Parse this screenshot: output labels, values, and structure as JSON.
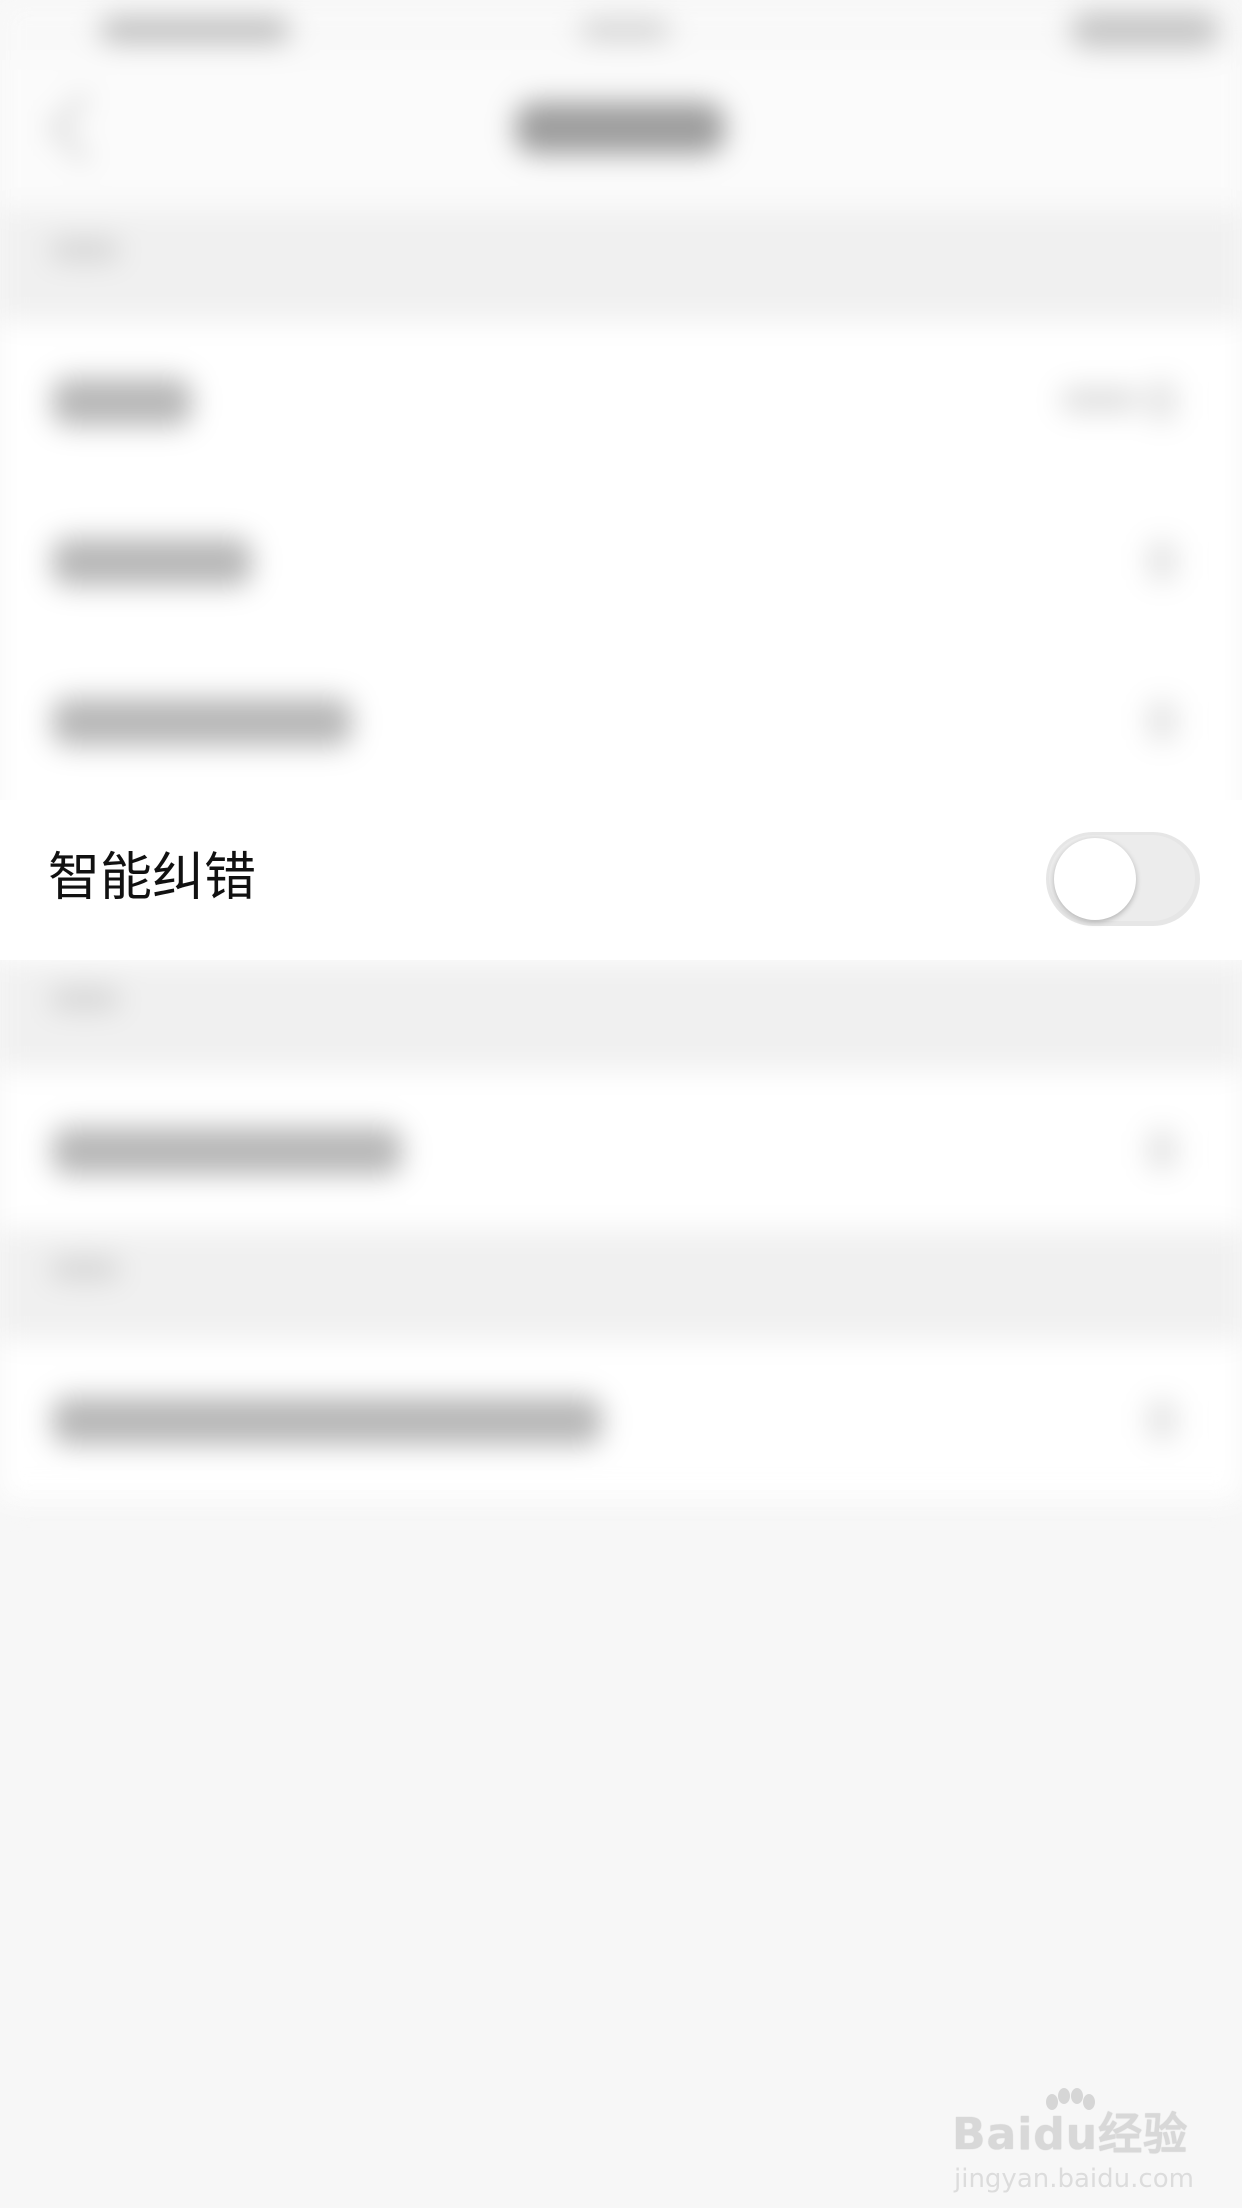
{
  "setting": {
    "label": "智能纠错",
    "enabled": false
  },
  "watermark": {
    "brand": "Baidu经验",
    "url": "jingyan.baidu.com"
  },
  "colors": {
    "background": "#f7f7f7",
    "row": "#ffffff",
    "toggle_track_off": "#e6e6e6",
    "toggle_knob": "#ffffff",
    "label_text": "#111111"
  },
  "icons": {
    "back": "chevron-left-icon",
    "watermark": "paw-icon"
  }
}
